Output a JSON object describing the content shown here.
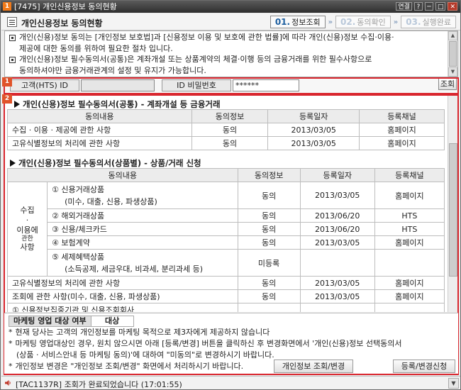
{
  "window": {
    "number_badge": "1",
    "title": "[7475] 개인신용정보 동의현황",
    "controls": [
      "연결",
      "?",
      "─",
      "□",
      "✕"
    ]
  },
  "header": {
    "title": "개인신용정보 동의현황",
    "steps": [
      {
        "num": "01.",
        "label": "정보조회"
      },
      {
        "num": "02.",
        "label": "동의확인"
      },
      {
        "num": "03.",
        "label": "실행완료"
      }
    ]
  },
  "notice": [
    "개인(신용)정보 동의는 [개인정보 보호법]과 [신용정보 이용 및 보호에 관한 법률]에 따라 개인(신용)정보 수집·이용·",
    "제공에 대한 동의를 위하여 필요한 절차 입니다.",
    "개인(신용)정보 필수동의서(공통)은 계좌개설 또는 상품계약의 체결·이행 등의 금융거래를 위한 필수사항으로",
    "동의하셔야만 금융거래관계의 설정 및 유지가 가능합니다."
  ],
  "login": {
    "badge": "1",
    "id_label": "고객(HTS) ID",
    "id_value": "",
    "pw_label": "ID 비밀번호",
    "pw_value": "******",
    "search_button": "조회"
  },
  "section2": {
    "badge": "2",
    "common": {
      "title": "개인(신용)정보 필수동의서(공통) - 계좌개설 등 금융거래",
      "columns": [
        "동의내용",
        "동의정보",
        "등록일자",
        "등록채널"
      ],
      "rows": [
        {
          "content": "수집 · 이용 · 제공에 관한 사항",
          "status": "동의",
          "date": "2013/03/05",
          "channel": "홈페이지"
        },
        {
          "content": "고유식별정보의 처리에 관한 사항",
          "status": "동의",
          "date": "2013/03/05",
          "channel": "홈페이지"
        }
      ]
    },
    "product": {
      "title": "개인(신용)정보 필수동의서(상품별) - 상품/거래 신청",
      "columns": [
        "동의내용",
        "동의정보",
        "등록일자",
        "등록채널"
      ],
      "group_label_1": "수집",
      "group_label_2": "·",
      "group_label_3": "이용에",
      "group_label_4": "관한",
      "group_label_5": "사항",
      "group_rows": [
        {
          "line1": "① 신용거래상품",
          "line2": "(미수, 대출, 신용, 파생상품)",
          "status": "동의",
          "date": "2013/03/05",
          "channel": "홈페이지"
        },
        {
          "line1": "② 해외거래상품",
          "line2": "",
          "status": "동의",
          "date": "2013/06/20",
          "channel": "HTS"
        },
        {
          "line1": "③ 신용/체크카드",
          "line2": "",
          "status": "동의",
          "date": "2013/06/20",
          "channel": "HTS"
        },
        {
          "line1": "④ 보험계약",
          "line2": "",
          "status": "동의",
          "date": "2013/03/05",
          "channel": "홈페이지"
        },
        {
          "line1": "⑤ 세제혜택상품",
          "line2": "(소득공제, 세금우대, 비과세, 분리과세 등)",
          "status": "미등록",
          "date": "",
          "channel": ""
        }
      ],
      "rows": [
        {
          "content": "고유식별정보의 처리에 관한 사항",
          "status": "동의",
          "date": "2013/03/05",
          "channel": "홈페이지"
        },
        {
          "content": "조회에 관한 사항(미수, 대출, 신용, 파생상품)",
          "status": "동의",
          "date": "2013/03/05",
          "channel": "홈페이지"
        }
      ],
      "partial_row": "① 신용정보집중기관 및 신용조회회사"
    }
  },
  "bottom": {
    "marketing_label": "마케팅 영업 대상 여부",
    "marketing_value": "대상",
    "lines": [
      "현재 당사는 고객의 개인정보를 마케팅 목적으로 제3자에게 제공하지 않습니다",
      "마케팅 영업대상인 경우, 원치 않으시면 아래 [등록/변경] 버튼을 클릭하신 후 변경화면에서 '개인(신용)정보 선택동의서",
      "(상품 · 서비스안내 등 마케팅 동의)'에 대하여 \"미동의\"로 변경하시기 바랍니다.",
      "개인정보 변경은 \"개인정보 조회/변경\" 화면에서 처리하시기 바랍니다."
    ],
    "bullet": "*",
    "change_info_button": "개인정보 조회/변경",
    "register_button": "등록/변경신청"
  },
  "status": {
    "message": "[TAC1137R] 조회가 완료되었습니다 (17:01:55)"
  }
}
